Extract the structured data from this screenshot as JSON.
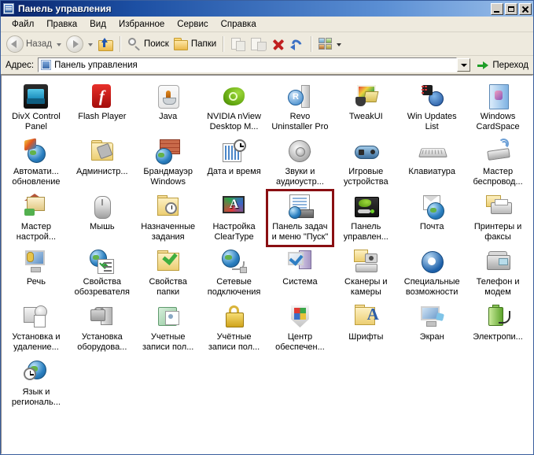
{
  "window": {
    "title": "Панель управления",
    "buttons": {
      "minimize": "_",
      "maximize": "▫",
      "close": "✕"
    }
  },
  "menubar": {
    "items": [
      {
        "label": "Файл",
        "name": "menu-file"
      },
      {
        "label": "Правка",
        "name": "menu-edit"
      },
      {
        "label": "Вид",
        "name": "menu-view"
      },
      {
        "label": "Избранное",
        "name": "menu-favorites"
      },
      {
        "label": "Сервис",
        "name": "menu-tools"
      },
      {
        "label": "Справка",
        "name": "menu-help"
      }
    ]
  },
  "toolbar": {
    "back_label": "Назад",
    "search_label": "Поиск",
    "folders_label": "Папки"
  },
  "address": {
    "label": "Адрес:",
    "value": "Панель управления",
    "go_label": "Переход"
  },
  "items": [
    {
      "label": "DivX Control\nPanel",
      "icon": "divx-control-panel-icon",
      "selected": false
    },
    {
      "label": "Flash Player",
      "icon": "flash-player-icon",
      "selected": false
    },
    {
      "label": "Java",
      "icon": "java-icon",
      "selected": false
    },
    {
      "label": "NVIDIA nView\nDesktop M...",
      "icon": "nvidia-nview-icon",
      "selected": false
    },
    {
      "label": "Revo\nUninstaller Pro",
      "icon": "revo-uninstaller-icon",
      "selected": false
    },
    {
      "label": "TweakUI",
      "icon": "tweakui-icon",
      "selected": false
    },
    {
      "label": "Win Updates\nList",
      "icon": "win-updates-list-icon",
      "selected": false
    },
    {
      "label": "Windows\nCardSpace",
      "icon": "windows-cardspace-icon",
      "selected": false
    },
    {
      "label": "Автомати...\nобновление",
      "icon": "automatic-updates-icon",
      "selected": false
    },
    {
      "label": "Администр...",
      "icon": "administrative-tools-icon",
      "selected": false
    },
    {
      "label": "Брандмауэр\nWindows",
      "icon": "windows-firewall-icon",
      "selected": false
    },
    {
      "label": "Дата и время",
      "icon": "date-and-time-icon",
      "selected": false
    },
    {
      "label": "Звуки и\nаудиоустр...",
      "icon": "sounds-and-audio-icon",
      "selected": false
    },
    {
      "label": "Игровые\nустройства",
      "icon": "game-controllers-icon",
      "selected": false
    },
    {
      "label": "Клавиатура",
      "icon": "keyboard-icon",
      "selected": false
    },
    {
      "label": "Мастер\nбеспровод...",
      "icon": "wireless-network-wizard-icon",
      "selected": false
    },
    {
      "label": "Мастер\nнастрой...",
      "icon": "network-setup-wizard-icon",
      "selected": false
    },
    {
      "label": "Мышь",
      "icon": "mouse-icon",
      "selected": false
    },
    {
      "label": "Назначенные\nзадания",
      "icon": "scheduled-tasks-icon",
      "selected": false
    },
    {
      "label": "Настройка\nClearType",
      "icon": "cleartype-tuning-icon",
      "selected": false
    },
    {
      "label": "Панель задач\nи меню \"Пуск\"",
      "icon": "taskbar-and-start-menu-icon",
      "selected": true
    },
    {
      "label": "Панель\nуправлен...",
      "icon": "nvidia-control-panel-icon",
      "selected": false
    },
    {
      "label": "Почта",
      "icon": "mail-icon",
      "selected": false
    },
    {
      "label": "Принтеры и\nфаксы",
      "icon": "printers-and-faxes-icon",
      "selected": false
    },
    {
      "label": "Речь",
      "icon": "speech-icon",
      "selected": false
    },
    {
      "label": "Свойства\nобозревателя",
      "icon": "internet-options-icon",
      "selected": false
    },
    {
      "label": "Свойства\nпапки",
      "icon": "folder-options-icon",
      "selected": false
    },
    {
      "label": "Сетевые\nподключения",
      "icon": "network-connections-icon",
      "selected": false
    },
    {
      "label": "Система",
      "icon": "system-icon",
      "selected": false
    },
    {
      "label": "Сканеры и\nкамеры",
      "icon": "scanners-and-cameras-icon",
      "selected": false
    },
    {
      "label": "Специальные\nвозможности",
      "icon": "accessibility-options-icon",
      "selected": false
    },
    {
      "label": "Телефон и\nмодем",
      "icon": "phone-and-modem-icon",
      "selected": false
    },
    {
      "label": "Установка и\nудаление...",
      "icon": "add-remove-programs-icon",
      "selected": false
    },
    {
      "label": "Установка\nоборудова...",
      "icon": "add-hardware-icon",
      "selected": false
    },
    {
      "label": "Учетные\nзаписи пол...",
      "icon": "user-accounts-icon",
      "selected": false
    },
    {
      "label": "Учётные\nзаписи пол...",
      "icon": "user-accounts-2-icon",
      "selected": false
    },
    {
      "label": "Центр\nобеспечен...",
      "icon": "security-center-icon",
      "selected": false
    },
    {
      "label": "Шрифты",
      "icon": "fonts-icon",
      "selected": false
    },
    {
      "label": "Экран",
      "icon": "display-icon",
      "selected": false
    },
    {
      "label": "Электропи...",
      "icon": "power-options-icon",
      "selected": false
    },
    {
      "label": "Язык и\nрегиональ...",
      "icon": "regional-and-language-icon",
      "selected": false
    }
  ]
}
